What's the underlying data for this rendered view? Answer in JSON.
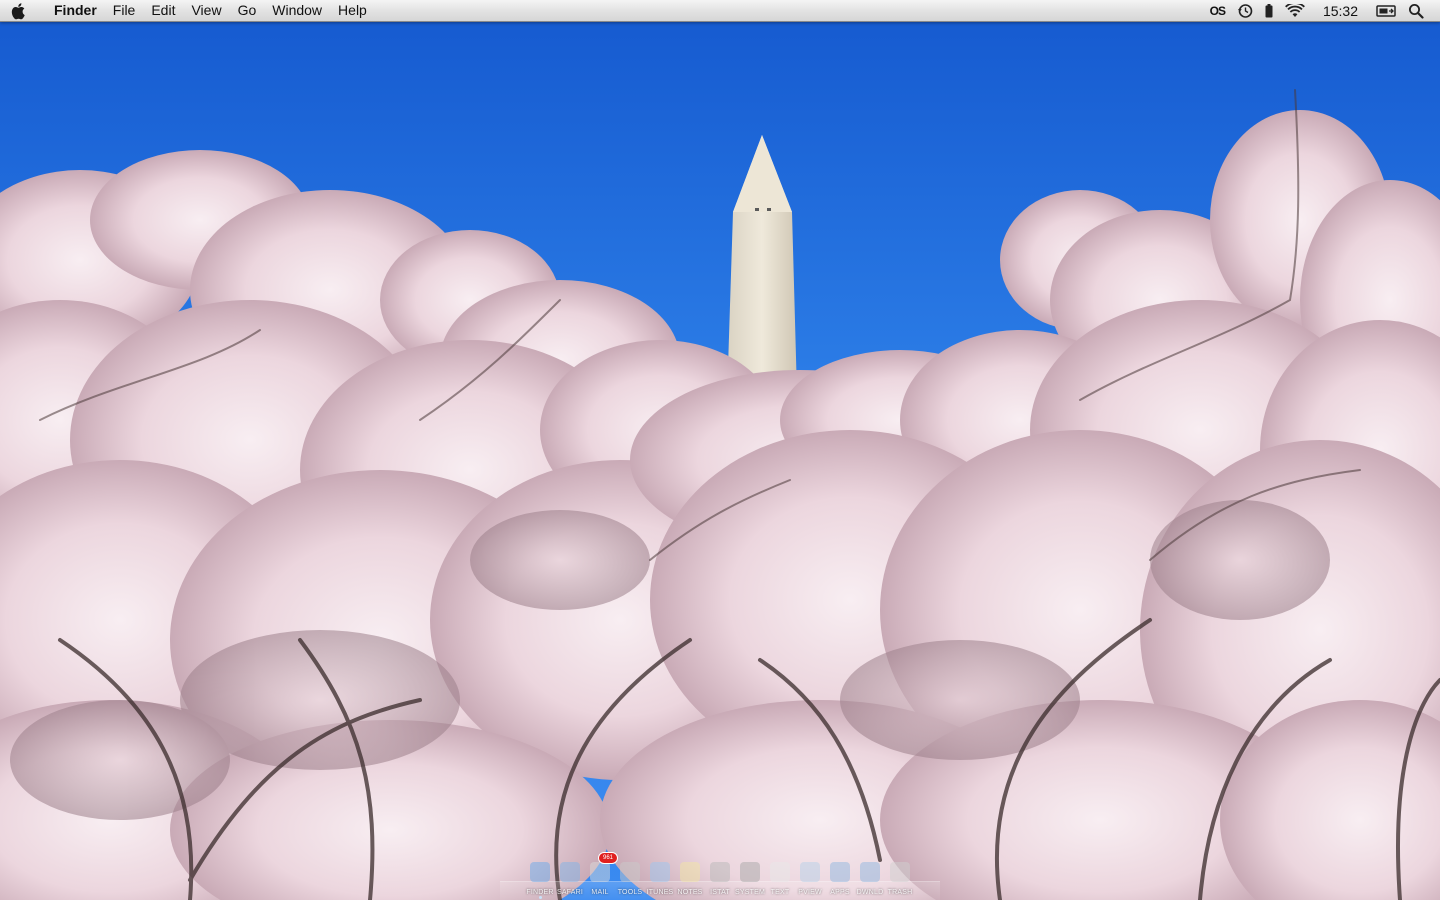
{
  "menubar": {
    "apple_icon": "apple-logo-icon",
    "app_name": "Finder",
    "menus": [
      "File",
      "Edit",
      "View",
      "Go",
      "Window",
      "Help"
    ],
    "status": {
      "ignore_icon": "script-menu-icon",
      "ignore_text": "OS",
      "time_machine_icon": "time-machine-icon",
      "battery_icon": "battery-icon",
      "wifi_icon": "wifi-icon",
      "clock": "15:32",
      "display_icon": "screen-mirroring-icon",
      "spotlight_icon": "spotlight-search-icon"
    }
  },
  "wallpaper": {
    "description_colors": {
      "sky": "#2a7ae6",
      "blossom": "#f1dfe5",
      "monument": "#e8e2d4"
    }
  },
  "dock": {
    "items": [
      {
        "label": "FINDER",
        "color": "#6aa9e9",
        "running": true
      },
      {
        "label": "SAFARI",
        "color": "#7fb4e8",
        "running": false
      },
      {
        "label": "MAIL",
        "color": "#d9d9d9",
        "running": false,
        "badge": "961"
      },
      {
        "label": "TOOLS",
        "color": "#c9c9c9",
        "running": false
      },
      {
        "label": "ITUNES",
        "color": "#9cc6ef",
        "running": false
      },
      {
        "label": "NOTES",
        "color": "#f1e6a3",
        "running": false
      },
      {
        "label": "ISTAT",
        "color": "#b8b8b8",
        "running": false
      },
      {
        "label": "SYSTEM",
        "color": "#a8a8a8",
        "running": false
      },
      {
        "label": "TEXT",
        "color": "#e8e8e8",
        "running": false
      },
      {
        "label": "PVIEW",
        "color": "#b6cfe8",
        "running": false
      },
      {
        "label": "APPS",
        "color": "#8fb8e0",
        "running": false
      },
      {
        "label": "DWNLD",
        "color": "#8fb8e0",
        "running": false
      },
      {
        "label": "TRASH",
        "color": "#cfcfcf",
        "running": false
      }
    ]
  }
}
